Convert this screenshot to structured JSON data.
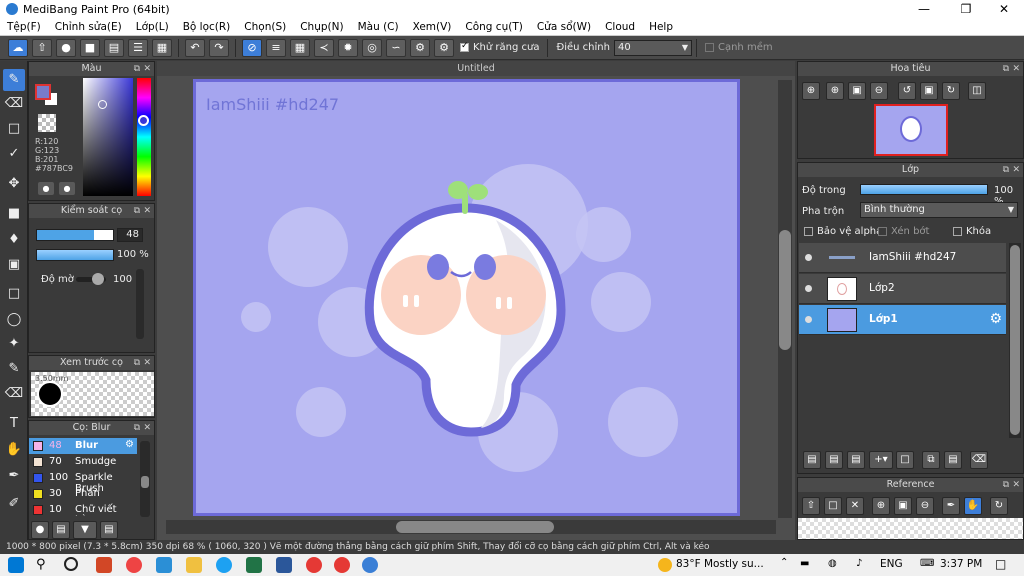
{
  "window": {
    "title": "MediBang Paint Pro (64bit)"
  },
  "menu": [
    "Tệp(F)",
    "Chỉnh sửa(E)",
    "Lớp(L)",
    "Bộ lọc(R)",
    "Chọn(S)",
    "Chụp(N)",
    "Màu (C)",
    "Xem(V)",
    "Công cụ(T)",
    "Cửa sổ(W)",
    "Cloud",
    "Help"
  ],
  "toolbar": {
    "antialias_label": "Khử răng cưa",
    "correction_label": "Điều chỉnh",
    "correction_value": "40",
    "soft_edge_label": "Cạnh mềm"
  },
  "color_panel": {
    "title": "Màu",
    "r": "R:120",
    "g": "G:123",
    "b": "B:201",
    "hex": "#787BC9",
    "main_color": "#787bc9"
  },
  "brush_control": {
    "title": "Kiểm soát cọ",
    "size_value": "48",
    "opacity_value": "100 %",
    "blur_label": "Độ mờ",
    "blur_value": "100"
  },
  "preview": {
    "title": "Xem trước cọ",
    "size_text": "3.50mm"
  },
  "brush_list": {
    "title": "Cọ: Blur",
    "items": [
      {
        "size": "48",
        "name": "Blur",
        "color": "#f6b3e8"
      },
      {
        "size": "70",
        "name": "Smudge",
        "color": "#f3e3d3"
      },
      {
        "size": "100",
        "name": "Sparkle Brush",
        "color": "#3355ee"
      },
      {
        "size": "30",
        "name": "Phấn",
        "color": "#f0e020"
      },
      {
        "size": "10",
        "name": "Chữ viết bằng...",
        "color": "#ee3333"
      }
    ]
  },
  "document": {
    "tab": "Untitled",
    "watermark": "IamShiii #hd247"
  },
  "navigator": {
    "title": "Hoa tiêu"
  },
  "layers": {
    "title": "Lớp",
    "opacity_label": "Độ trong",
    "opacity_value": "100 %",
    "blend_label": "Pha trộn",
    "blend_value": "Bình thường",
    "protect_alpha": "Bảo vệ alpha",
    "clip": "Xén bớt",
    "lock": "Khóa",
    "items": [
      {
        "name": "IamShiii #hd247"
      },
      {
        "name": "Lớp2"
      },
      {
        "name": "Lớp1"
      }
    ]
  },
  "reference": {
    "title": "Reference"
  },
  "status": {
    "text": "1000 * 800 pixel   (7.3 * 5.8cm)   350 dpi   68 %   ( 1060, 320 )   Vẽ một đường thẳng bằng cách giữ phím Shift, Thay đổi cỡ cọ bằng cách giữ phím Ctrl, Alt và kéo"
  },
  "taskbar": {
    "weather": "83°F  Mostly su...",
    "lang": "ENG",
    "time": "3:37 PM"
  }
}
